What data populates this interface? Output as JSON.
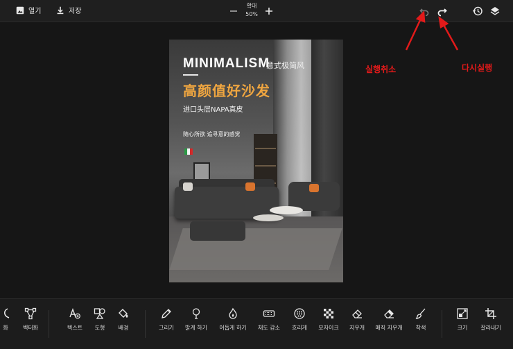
{
  "topbar": {
    "open_label": "열기",
    "save_label": "저장",
    "zoom_label": "확대",
    "zoom_value": "50%"
  },
  "poster": {
    "title": "MINIMALISM",
    "title_cn": "意式极简风",
    "headline": "高颜值好沙发",
    "subline": "进口头层NAPA真皮",
    "tagline": "随心所欲 追寻意的感觉"
  },
  "annotations": {
    "undo": "실행취소",
    "redo": "다시실행"
  },
  "toolbar": {
    "tools": [
      {
        "id": "partial",
        "label": "화"
      },
      {
        "id": "vectorize",
        "label": "벡터화"
      },
      {
        "id": "text",
        "label": "텍스트"
      },
      {
        "id": "shape",
        "label": "도형"
      },
      {
        "id": "background",
        "label": "배경"
      },
      {
        "id": "draw",
        "label": "그리기"
      },
      {
        "id": "brighten",
        "label": "밝게 하기"
      },
      {
        "id": "darken",
        "label": "어둡게 하기"
      },
      {
        "id": "desaturate",
        "label": "채도 감소"
      },
      {
        "id": "blur",
        "label": "흐리게"
      },
      {
        "id": "mosaic",
        "label": "모자이크"
      },
      {
        "id": "eraser",
        "label": "지우개"
      },
      {
        "id": "magic-eraser",
        "label": "매직 지우개"
      },
      {
        "id": "colorize",
        "label": "착색"
      },
      {
        "id": "resize",
        "label": "크기"
      },
      {
        "id": "crop",
        "label": "잘라내기"
      }
    ]
  },
  "colors": {
    "annotation": "#e21a1a",
    "headline": "#f0a640",
    "background": "#161616"
  }
}
